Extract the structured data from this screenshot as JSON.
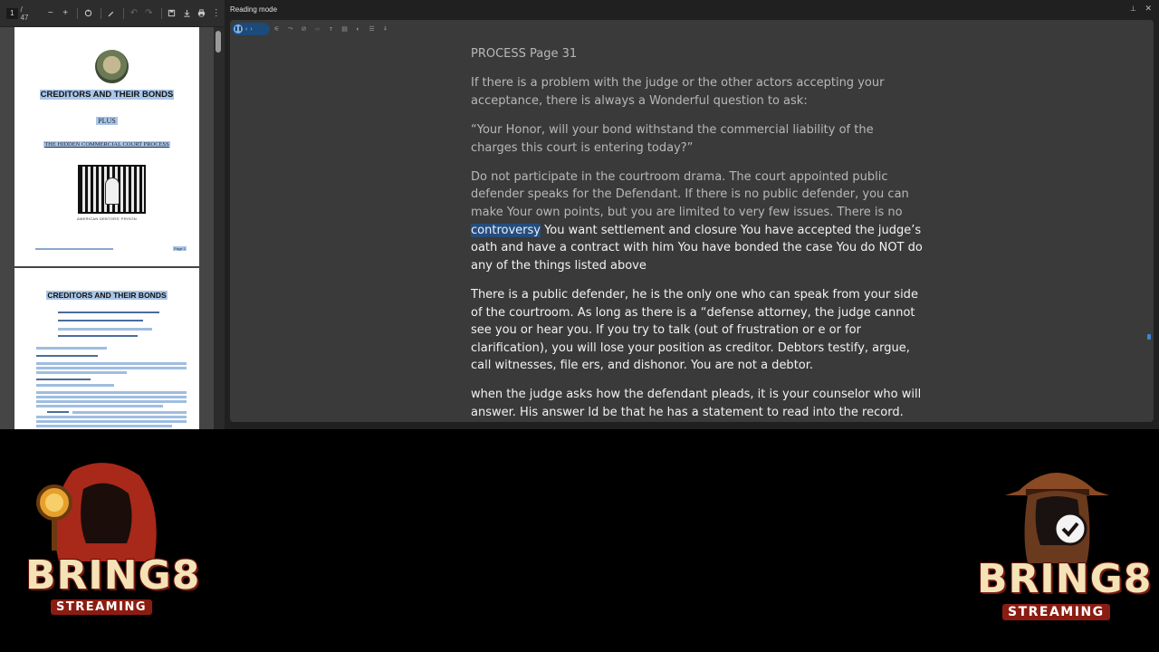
{
  "pdf_viewer": {
    "current_page": "1",
    "total_pages": "/ 47",
    "thumb1": {
      "title": "CREDITORS AND THEIR BONDS",
      "plus": "PLUS",
      "subtitle": "THE HIDDEN COMMERCIAL COURT PROCESS",
      "caption": "AMERICAN DEBTORS' PRISON",
      "page_label": "Page 1"
    },
    "thumb2": {
      "title": "CREDITORS AND THEIR BONDS"
    }
  },
  "reading_mode": {
    "window_title": "Reading mode",
    "paragraphs": {
      "p1": "PROCESS Page 31",
      "p2": "If there is a problem with the judge or the other actors accepting your acceptance, there is always a Wonderful question to ask:",
      "p3": "“Your Honor, will your bond withstand the commercial liability of the charges this court is entering today?”",
      "p4_before": "Do not participate in the courtroom drama. The court appointed public defender speaks for the Defendant. If there is no public defender, you can make Your own points, but you are limited to very few issues. There is no ",
      "p4_selected": "controversy",
      "p4_after": " You want settlement and closure You have accepted the judge’s oath and have a contract with him You have bonded the case You do NOT do any of the things listed above",
      "p5": "There is a public defender, he is the only one who can speak from your side of the courtroom. As long as there is a “defense attorney, the judge cannot see you or hear you. If you try to talk (out of frustration or e or for clarification), you will lose your position as creditor. Debtors testify, argue, call witnesses, file ers, and dishonor. You are not a debtor.",
      "p6": "when the judge asks how the defendant pleads, it is your counselor who will answer. His answer ld be that he has a statement to read into the record."
    }
  },
  "logos": {
    "left": {
      "word": "BRING8",
      "sub": "STREAMING"
    },
    "right": {
      "word": "BRING8",
      "sub": "STREAMING"
    }
  }
}
